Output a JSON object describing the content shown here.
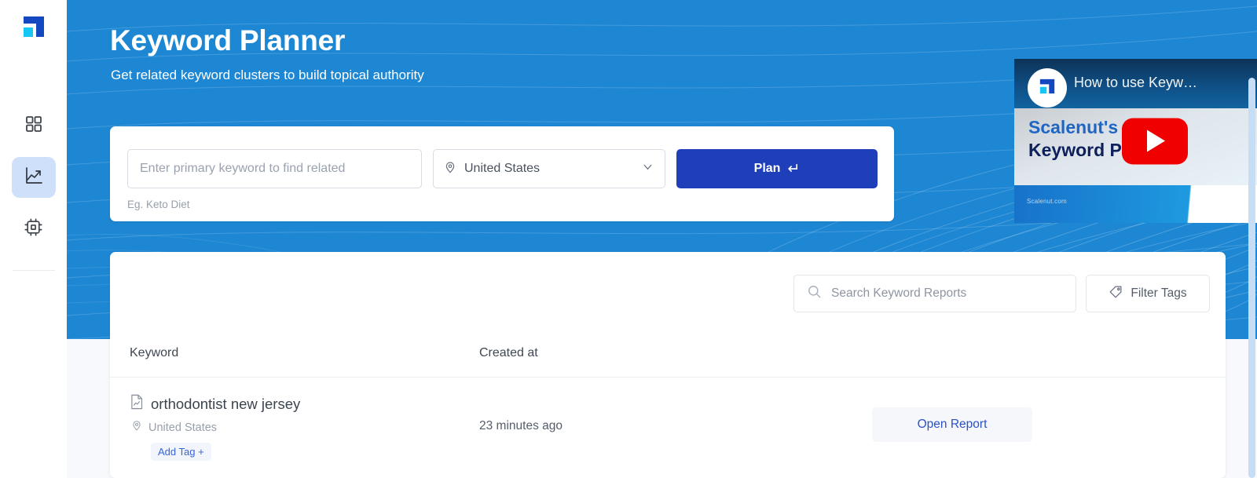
{
  "brand": {
    "logo_icon": "scalenut-logo-icon",
    "accent_blue": "#1e87d3",
    "primary_blue": "#1f3fba",
    "cyan": "#16c6f5"
  },
  "sidebar": {
    "items": [
      {
        "icon": "grid-dashboard-icon",
        "name": "dashboard",
        "active": false
      },
      {
        "icon": "trending-chart-icon",
        "name": "keyword-planner",
        "active": true
      },
      {
        "icon": "cpu-chip-icon",
        "name": "ai-tools",
        "active": false
      }
    ]
  },
  "hero": {
    "title": "Keyword Planner",
    "subtitle": "Get related keyword clusters to build topical authority"
  },
  "search_form": {
    "keyword_placeholder": "Enter primary keyword to find related",
    "keyword_value": "",
    "country_label": "United States",
    "country_icon": "location-pin-icon",
    "chevron_icon": "chevron-down-icon",
    "plan_label": "Plan",
    "plan_arrow": "↵",
    "hint": "Eg. Keto Diet"
  },
  "video": {
    "title": "How to use Keyw…",
    "headline_line1": "Scalenut's",
    "headline_line2": "Keyword Planner",
    "watermark": "Scalenut.com",
    "play_icon": "youtube-play-icon",
    "menu_icon": "more-vertical-icon",
    "avatar_icon": "scalenut-logo-icon"
  },
  "reports": {
    "search_placeholder": "Search Keyword Reports",
    "search_value": "",
    "search_icon": "search-icon",
    "filter_label": "Filter Tags",
    "filter_icon": "tag-icon",
    "columns": {
      "keyword": "Keyword",
      "created_at": "Created at"
    },
    "rows": [
      {
        "keyword": "orthodontist new jersey",
        "keyword_icon": "report-document-icon",
        "location": "United States",
        "location_icon": "location-pin-icon",
        "tag_label": "Add Tag +",
        "created_at": "23 minutes ago",
        "action_label": "Open Report"
      }
    ]
  }
}
